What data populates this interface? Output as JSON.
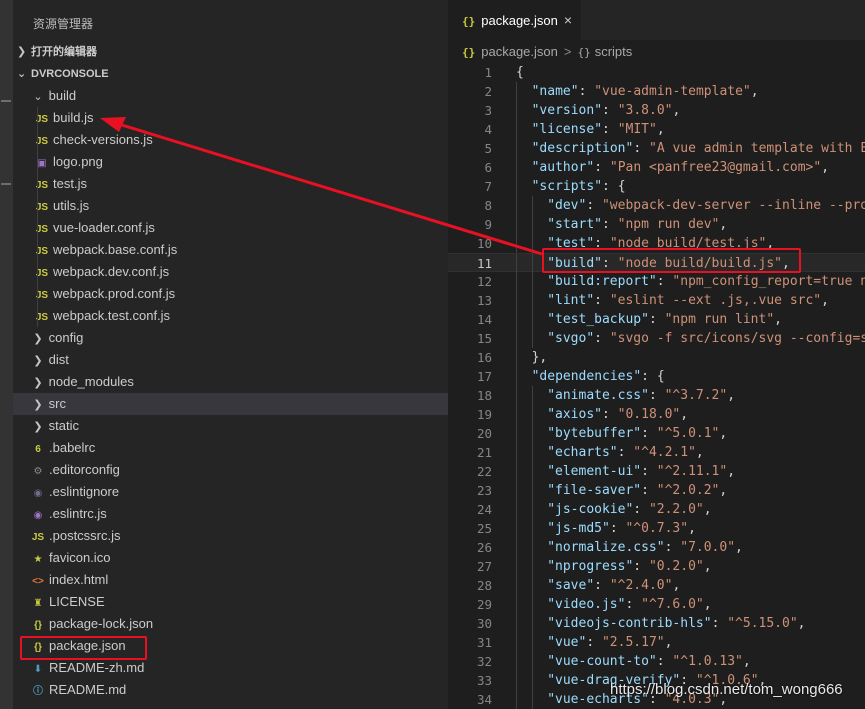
{
  "explorer": {
    "title": "资源管理器",
    "open_editors": "打开的编辑器",
    "workspace": "DVRCONSOLE"
  },
  "tree": [
    {
      "label": "build",
      "kind": "folder-open",
      "level": 1
    },
    {
      "label": "build.js",
      "kind": "js",
      "level": 2
    },
    {
      "label": "check-versions.js",
      "kind": "js",
      "level": 2
    },
    {
      "label": "logo.png",
      "kind": "image",
      "level": 2
    },
    {
      "label": "test.js",
      "kind": "js",
      "level": 2
    },
    {
      "label": "utils.js",
      "kind": "js",
      "level": 2
    },
    {
      "label": "vue-loader.conf.js",
      "kind": "js",
      "level": 2
    },
    {
      "label": "webpack.base.conf.js",
      "kind": "js",
      "level": 2
    },
    {
      "label": "webpack.dev.conf.js",
      "kind": "js",
      "level": 2
    },
    {
      "label": "webpack.prod.conf.js",
      "kind": "js",
      "level": 2
    },
    {
      "label": "webpack.test.conf.js",
      "kind": "js",
      "level": 2
    },
    {
      "label": "config",
      "kind": "folder",
      "level": 1
    },
    {
      "label": "dist",
      "kind": "folder",
      "level": 1
    },
    {
      "label": "node_modules",
      "kind": "folder",
      "level": 1
    },
    {
      "label": "src",
      "kind": "folder",
      "level": 1,
      "selected": true
    },
    {
      "label": "static",
      "kind": "folder",
      "level": 1
    },
    {
      "label": ".babelrc",
      "kind": "babel",
      "level": 1
    },
    {
      "label": ".editorconfig",
      "kind": "gear",
      "level": 1
    },
    {
      "label": ".eslintignore",
      "kind": "eslint-ignore",
      "level": 1
    },
    {
      "label": ".eslintrc.js",
      "kind": "eslint",
      "level": 1
    },
    {
      "label": ".postcssrc.js",
      "kind": "js",
      "level": 1
    },
    {
      "label": "favicon.ico",
      "kind": "star",
      "level": 1
    },
    {
      "label": "index.html",
      "kind": "html",
      "level": 1
    },
    {
      "label": "LICENSE",
      "kind": "license",
      "level": 1
    },
    {
      "label": "package-lock.json",
      "kind": "json",
      "level": 1
    },
    {
      "label": "package.json",
      "kind": "json",
      "level": 1,
      "highlighted": true
    },
    {
      "label": "README-zh.md",
      "kind": "markdown",
      "level": 1
    },
    {
      "label": "README.md",
      "kind": "info",
      "level": 1
    }
  ],
  "tab": {
    "label": "package.json",
    "close": "×",
    "braces": "{}"
  },
  "breadcrumb": {
    "file": "package.json",
    "separator": ">",
    "symbol_icon": "{}",
    "symbol": "scripts"
  },
  "code": {
    "current_line": 11,
    "lines": [
      {
        "n": "1",
        "indent": 0,
        "tokens": [
          {
            "t": "p",
            "v": "{"
          }
        ]
      },
      {
        "n": "2",
        "indent": 1,
        "tokens": [
          {
            "t": "k",
            "v": "\"name\""
          },
          {
            "t": "p",
            "v": ": "
          },
          {
            "t": "s",
            "v": "\"vue-admin-template\""
          },
          {
            "t": "p",
            "v": ","
          }
        ]
      },
      {
        "n": "3",
        "indent": 1,
        "tokens": [
          {
            "t": "k",
            "v": "\"version\""
          },
          {
            "t": "p",
            "v": ": "
          },
          {
            "t": "s",
            "v": "\"3.8.0\""
          },
          {
            "t": "p",
            "v": ","
          }
        ]
      },
      {
        "n": "4",
        "indent": 1,
        "tokens": [
          {
            "t": "k",
            "v": "\"license\""
          },
          {
            "t": "p",
            "v": ": "
          },
          {
            "t": "s",
            "v": "\"MIT\""
          },
          {
            "t": "p",
            "v": ","
          }
        ]
      },
      {
        "n": "5",
        "indent": 1,
        "tokens": [
          {
            "t": "k",
            "v": "\"description\""
          },
          {
            "t": "p",
            "v": ": "
          },
          {
            "t": "s",
            "v": "\"A vue admin template with El"
          }
        ]
      },
      {
        "n": "6",
        "indent": 1,
        "tokens": [
          {
            "t": "k",
            "v": "\"author\""
          },
          {
            "t": "p",
            "v": ": "
          },
          {
            "t": "s",
            "v": "\"Pan <panfree23@gmail.com>\""
          },
          {
            "t": "p",
            "v": ","
          }
        ]
      },
      {
        "n": "7",
        "indent": 1,
        "tokens": [
          {
            "t": "k",
            "v": "\"scripts\""
          },
          {
            "t": "p",
            "v": ": {"
          }
        ]
      },
      {
        "n": "8",
        "indent": 2,
        "tokens": [
          {
            "t": "k",
            "v": "\"dev\""
          },
          {
            "t": "p",
            "v": ": "
          },
          {
            "t": "s",
            "v": "\"webpack-dev-server --inline --prog"
          }
        ]
      },
      {
        "n": "9",
        "indent": 2,
        "tokens": [
          {
            "t": "k",
            "v": "\"start\""
          },
          {
            "t": "p",
            "v": ": "
          },
          {
            "t": "s",
            "v": "\"npm run dev\""
          },
          {
            "t": "p",
            "v": ","
          }
        ]
      },
      {
        "n": "10",
        "indent": 2,
        "tokens": [
          {
            "t": "k",
            "v": "\"test\""
          },
          {
            "t": "p",
            "v": ": "
          },
          {
            "t": "s",
            "v": "\"node build/test.js\""
          },
          {
            "t": "p",
            "v": ","
          }
        ]
      },
      {
        "n": "11",
        "indent": 2,
        "tokens": [
          {
            "t": "k",
            "v": "\"build\""
          },
          {
            "t": "p",
            "v": ": "
          },
          {
            "t": "s",
            "v": "\"node build/build.js\""
          },
          {
            "t": "p",
            "v": ","
          }
        ]
      },
      {
        "n": "12",
        "indent": 2,
        "tokens": [
          {
            "t": "k",
            "v": "\"build:report\""
          },
          {
            "t": "p",
            "v": ": "
          },
          {
            "t": "s",
            "v": "\"npm_config_report=true np"
          }
        ]
      },
      {
        "n": "13",
        "indent": 2,
        "tokens": [
          {
            "t": "k",
            "v": "\"lint\""
          },
          {
            "t": "p",
            "v": ": "
          },
          {
            "t": "s",
            "v": "\"eslint --ext .js,.vue src\""
          },
          {
            "t": "p",
            "v": ","
          }
        ]
      },
      {
        "n": "14",
        "indent": 2,
        "tokens": [
          {
            "t": "k",
            "v": "\"test_backup\""
          },
          {
            "t": "p",
            "v": ": "
          },
          {
            "t": "s",
            "v": "\"npm run lint\""
          },
          {
            "t": "p",
            "v": ","
          }
        ]
      },
      {
        "n": "15",
        "indent": 2,
        "tokens": [
          {
            "t": "k",
            "v": "\"svgo\""
          },
          {
            "t": "p",
            "v": ": "
          },
          {
            "t": "s",
            "v": "\"svgo -f src/icons/svg --config=sr"
          }
        ]
      },
      {
        "n": "16",
        "indent": 1,
        "tokens": [
          {
            "t": "p",
            "v": "},"
          }
        ]
      },
      {
        "n": "17",
        "indent": 1,
        "tokens": [
          {
            "t": "k",
            "v": "\"dependencies\""
          },
          {
            "t": "p",
            "v": ": {"
          }
        ]
      },
      {
        "n": "18",
        "indent": 2,
        "tokens": [
          {
            "t": "k",
            "v": "\"animate.css\""
          },
          {
            "t": "p",
            "v": ": "
          },
          {
            "t": "s",
            "v": "\"^3.7.2\""
          },
          {
            "t": "p",
            "v": ","
          }
        ]
      },
      {
        "n": "19",
        "indent": 2,
        "tokens": [
          {
            "t": "k",
            "v": "\"axios\""
          },
          {
            "t": "p",
            "v": ": "
          },
          {
            "t": "s",
            "v": "\"0.18.0\""
          },
          {
            "t": "p",
            "v": ","
          }
        ]
      },
      {
        "n": "20",
        "indent": 2,
        "tokens": [
          {
            "t": "k",
            "v": "\"bytebuffer\""
          },
          {
            "t": "p",
            "v": ": "
          },
          {
            "t": "s",
            "v": "\"^5.0.1\""
          },
          {
            "t": "p",
            "v": ","
          }
        ]
      },
      {
        "n": "21",
        "indent": 2,
        "tokens": [
          {
            "t": "k",
            "v": "\"echarts\""
          },
          {
            "t": "p",
            "v": ": "
          },
          {
            "t": "s",
            "v": "\"^4.2.1\""
          },
          {
            "t": "p",
            "v": ","
          }
        ]
      },
      {
        "n": "22",
        "indent": 2,
        "tokens": [
          {
            "t": "k",
            "v": "\"element-ui\""
          },
          {
            "t": "p",
            "v": ": "
          },
          {
            "t": "s",
            "v": "\"^2.11.1\""
          },
          {
            "t": "p",
            "v": ","
          }
        ]
      },
      {
        "n": "23",
        "indent": 2,
        "tokens": [
          {
            "t": "k",
            "v": "\"file-saver\""
          },
          {
            "t": "p",
            "v": ": "
          },
          {
            "t": "s",
            "v": "\"^2.0.2\""
          },
          {
            "t": "p",
            "v": ","
          }
        ]
      },
      {
        "n": "24",
        "indent": 2,
        "tokens": [
          {
            "t": "k",
            "v": "\"js-cookie\""
          },
          {
            "t": "p",
            "v": ": "
          },
          {
            "t": "s",
            "v": "\"2.2.0\""
          },
          {
            "t": "p",
            "v": ","
          }
        ]
      },
      {
        "n": "25",
        "indent": 2,
        "tokens": [
          {
            "t": "k",
            "v": "\"js-md5\""
          },
          {
            "t": "p",
            "v": ": "
          },
          {
            "t": "s",
            "v": "\"^0.7.3\""
          },
          {
            "t": "p",
            "v": ","
          }
        ]
      },
      {
        "n": "26",
        "indent": 2,
        "tokens": [
          {
            "t": "k",
            "v": "\"normalize.css\""
          },
          {
            "t": "p",
            "v": ": "
          },
          {
            "t": "s",
            "v": "\"7.0.0\""
          },
          {
            "t": "p",
            "v": ","
          }
        ]
      },
      {
        "n": "27",
        "indent": 2,
        "tokens": [
          {
            "t": "k",
            "v": "\"nprogress\""
          },
          {
            "t": "p",
            "v": ": "
          },
          {
            "t": "s",
            "v": "\"0.2.0\""
          },
          {
            "t": "p",
            "v": ","
          }
        ]
      },
      {
        "n": "28",
        "indent": 2,
        "tokens": [
          {
            "t": "k",
            "v": "\"save\""
          },
          {
            "t": "p",
            "v": ": "
          },
          {
            "t": "s",
            "v": "\"^2.4.0\""
          },
          {
            "t": "p",
            "v": ","
          }
        ]
      },
      {
        "n": "29",
        "indent": 2,
        "tokens": [
          {
            "t": "k",
            "v": "\"video.js\""
          },
          {
            "t": "p",
            "v": ": "
          },
          {
            "t": "s",
            "v": "\"^7.6.0\""
          },
          {
            "t": "p",
            "v": ","
          }
        ]
      },
      {
        "n": "30",
        "indent": 2,
        "tokens": [
          {
            "t": "k",
            "v": "\"videojs-contrib-hls\""
          },
          {
            "t": "p",
            "v": ": "
          },
          {
            "t": "s",
            "v": "\"^5.15.0\""
          },
          {
            "t": "p",
            "v": ","
          }
        ]
      },
      {
        "n": "31",
        "indent": 2,
        "tokens": [
          {
            "t": "k",
            "v": "\"vue\""
          },
          {
            "t": "p",
            "v": ": "
          },
          {
            "t": "s",
            "v": "\"2.5.17\""
          },
          {
            "t": "p",
            "v": ","
          }
        ]
      },
      {
        "n": "32",
        "indent": 2,
        "tokens": [
          {
            "t": "k",
            "v": "\"vue-count-to\""
          },
          {
            "t": "p",
            "v": ": "
          },
          {
            "t": "s",
            "v": "\"^1.0.13\""
          },
          {
            "t": "p",
            "v": ","
          }
        ]
      },
      {
        "n": "33",
        "indent": 2,
        "tokens": [
          {
            "t": "k",
            "v": "\"vue-drag-verify\""
          },
          {
            "t": "p",
            "v": ": "
          },
          {
            "t": "s",
            "v": "\"^1.0.6\""
          },
          {
            "t": "p",
            "v": ","
          }
        ]
      },
      {
        "n": "34",
        "indent": 2,
        "tokens": [
          {
            "t": "k",
            "v": "\"vue-echarts\""
          },
          {
            "t": "p",
            "v": ": "
          },
          {
            "t": "s",
            "v": "\"4.0.3\""
          },
          {
            "t": "p",
            "v": ","
          }
        ]
      }
    ]
  },
  "watermark": "https://blog.csdn.net/tom_wong666",
  "colors": {
    "annotation_red": "#e81123",
    "json_key": "#9cdcfe",
    "json_string": "#ce9178",
    "js_icon": "#cbcb41"
  },
  "icons": {
    "chevron_right": "chevron-right-icon",
    "chevron_down": "chevron-down-icon",
    "js": "javascript-file-icon",
    "json": "json-file-icon",
    "image": "image-file-icon",
    "close": "close-icon"
  }
}
